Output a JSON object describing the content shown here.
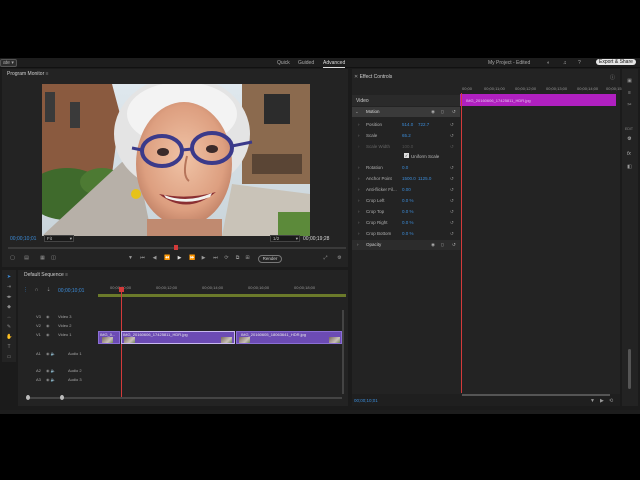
{
  "app": {
    "left_menu_fragment": "ate",
    "modes": [
      "Quick",
      "Guided",
      "Advanced"
    ],
    "active_mode": "Advanced",
    "project_title": "My Project - Edited",
    "export_label": "Export & Share"
  },
  "monitor": {
    "title": "Program Monitor",
    "timecode_left": "00;00;10;01",
    "zoom": "Fit",
    "quality": "1/2",
    "timecode_right": "00;00;19;28",
    "render_label": "Render"
  },
  "timeline": {
    "title": "Default Sequence",
    "timecode": "00;00;10;01",
    "ruler": [
      "00;00;10;00",
      "00;00;12;00",
      "00;00;14;00",
      "00;00;16;00",
      "00;00;18;00"
    ],
    "tracks": {
      "video": [
        "Video 3",
        "Video 2",
        "Video 1"
      ],
      "audio": [
        "Audio 1",
        "Audio 2",
        "Audio 3"
      ],
      "video_prefix": [
        "V3",
        "V2",
        "V1"
      ],
      "audio_prefix": [
        "A1",
        "A2",
        "A3"
      ]
    },
    "clips": [
      "IMG_0...",
      "IMG_20160606_17425811_HDR.jpg",
      "IMG_20160605_18063641_HDR.jpg"
    ]
  },
  "effect_controls": {
    "title": "Effect Controls",
    "ruler": [
      "00;00",
      "00;00;11;00",
      "00;00;12;00",
      "00;00;13;00",
      "00;00;14;00",
      "00;00;15;00"
    ],
    "section": "Video",
    "effect": "Motion",
    "properties": [
      {
        "label": "Position",
        "v1": "514.0",
        "v2": "722.7"
      },
      {
        "label": "Scale",
        "v1": "65.2",
        "v2": ""
      },
      {
        "label": "Scale Width",
        "v1": "100.0",
        "v2": ""
      },
      {
        "label": "Rotation",
        "v1": "0.0",
        "v2": ""
      },
      {
        "label": "Anchor Point",
        "v1": "1500.0",
        "v2": "1125.0"
      },
      {
        "label": "Anti-flicker Fil...",
        "v1": "0.00",
        "v2": ""
      },
      {
        "label": "Crop Left",
        "v1": "0.0 %",
        "v2": ""
      },
      {
        "label": "Crop Top",
        "v1": "0.0 %",
        "v2": ""
      },
      {
        "label": "Crop Right",
        "v1": "0.0 %",
        "v2": ""
      },
      {
        "label": "Crop Bottom",
        "v1": "0.0 %",
        "v2": ""
      }
    ],
    "uniform_scale": "Uniform Scale",
    "opacity": "Opacity",
    "clip_label": "IMG_20160606_17425811_HDR.jpg",
    "footer_timecode": "00;00;10;01"
  },
  "right_rail": {
    "edit_label": "EDIT",
    "fx_label": "fx"
  },
  "colors": {
    "accent_blue": "#3b8cd9",
    "clip_purple": "#6c4bb4",
    "playhead_red": "#d33a3a",
    "ec_clip_magenta": "#b020c0"
  }
}
